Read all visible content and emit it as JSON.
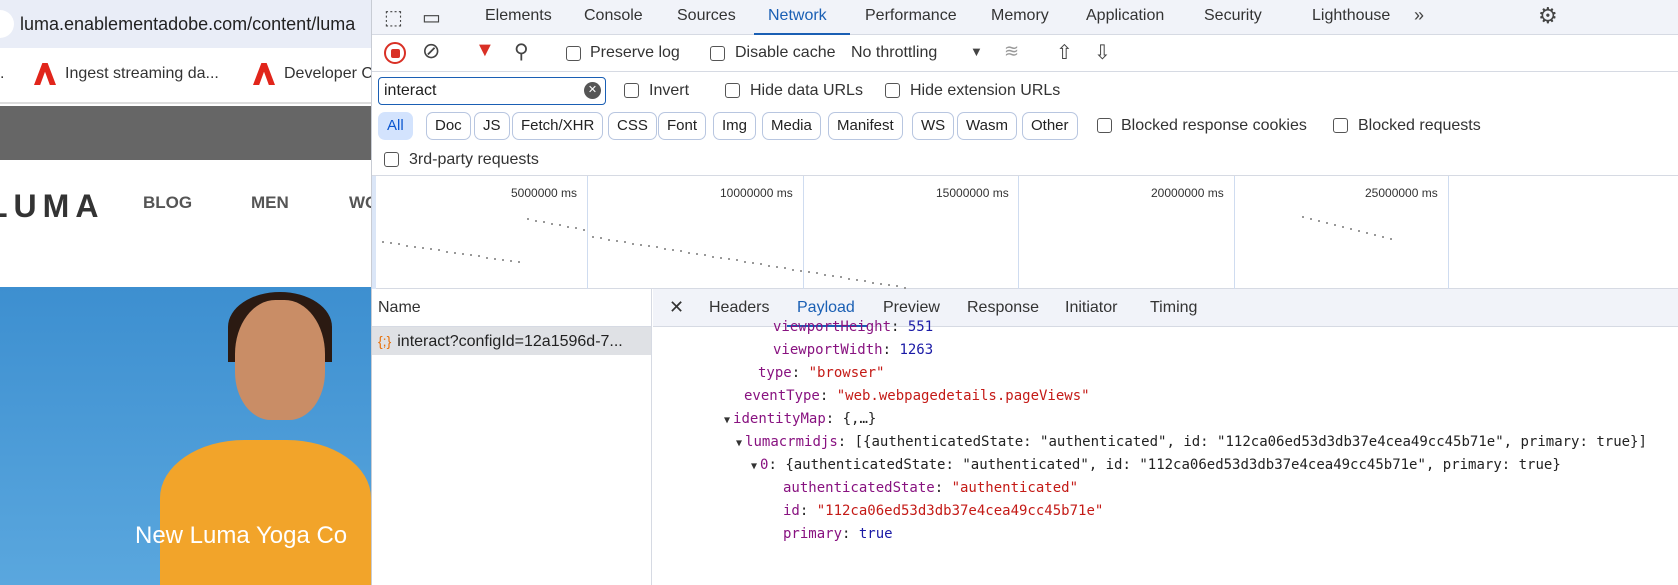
{
  "browser": {
    "url": "luma.enablementadobe.com/content/luma",
    "bookmarks": [
      "Ingest streaming da...",
      "Developer C"
    ]
  },
  "site": {
    "logo": "LUMA",
    "nav": [
      "BLOG",
      "MEN",
      "WO"
    ],
    "hero_text": "New Luma Yoga Co"
  },
  "devtools": {
    "tabs": [
      "Elements",
      "Console",
      "Sources",
      "Network",
      "Performance",
      "Memory",
      "Application",
      "Security",
      "Lighthouse"
    ],
    "active_tab": "Network",
    "toolbar": {
      "preserve_log": "Preserve log",
      "disable_cache": "Disable cache",
      "throttling": "No throttling"
    },
    "filter": {
      "value": "interact",
      "invert": "Invert",
      "hide_data": "Hide data URLs",
      "hide_ext": "Hide extension URLs",
      "types": [
        "All",
        "Doc",
        "JS",
        "Fetch/XHR",
        "CSS",
        "Font",
        "Img",
        "Media",
        "Manifest",
        "WS",
        "Wasm",
        "Other"
      ],
      "blocked_cookies": "Blocked response cookies",
      "blocked_requests": "Blocked requests",
      "third_party": "3rd-party requests"
    },
    "timeline_ticks": [
      "5000000 ms",
      "10000000 ms",
      "15000000 ms",
      "20000000 ms",
      "25000000 ms"
    ],
    "name_header": "Name",
    "request": "interact?configId=12a1596d-7...",
    "detail_tabs": [
      "Headers",
      "Payload",
      "Preview",
      "Response",
      "Initiator",
      "Timing"
    ],
    "payload": [
      {
        "k": "viewportHeight",
        "v": "551",
        "t": "n"
      },
      {
        "k": "viewportWidth",
        "v": "1263",
        "t": "n"
      },
      {
        "k": "type",
        "v": "\"browser\"",
        "t": "s"
      },
      {
        "k": "eventType",
        "v": "\"web.webpagedetails.pageViews\"",
        "t": "s"
      },
      {
        "k": "identityMap",
        "v": "{,…}",
        "t": "p"
      },
      {
        "k": "lumacrmidjs",
        "v": "[{authenticatedState: \"authenticated\", id: \"112ca06ed53d3db37e4cea49cc45b71e\", primary: true}]",
        "t": "p"
      },
      {
        "k": "0",
        "v": "{authenticatedState: \"authenticated\", id: \"112ca06ed53d3db37e4cea49cc45b71e\", primary: true}",
        "t": "p"
      },
      {
        "k": "authenticatedState",
        "v": "\"authenticated\"",
        "t": "s"
      },
      {
        "k": "id",
        "v": "\"112ca06ed53d3db37e4cea49cc45b71e\"",
        "t": "s"
      },
      {
        "k": "primary",
        "v": "true",
        "t": "n"
      }
    ]
  }
}
